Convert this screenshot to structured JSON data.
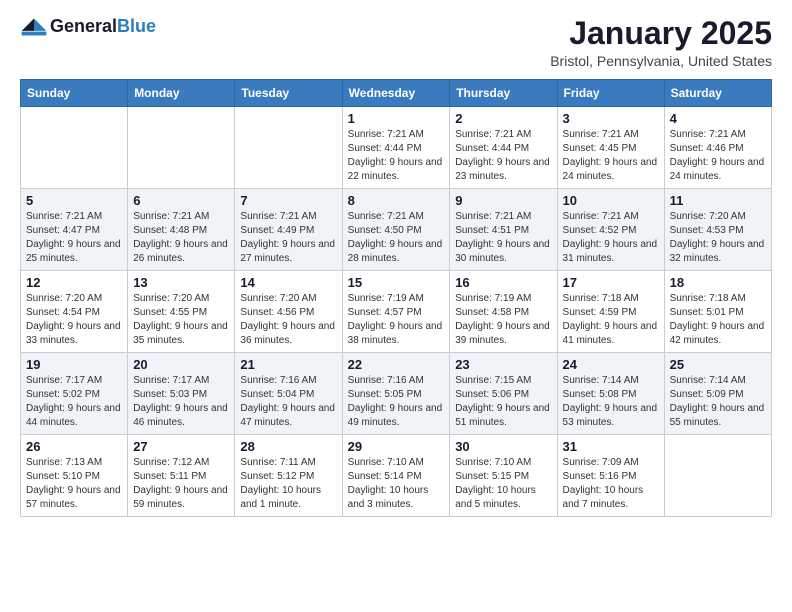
{
  "header": {
    "logo_general": "General",
    "logo_blue": "Blue",
    "month_title": "January 2025",
    "location": "Bristol, Pennsylvania, United States"
  },
  "days_of_week": [
    "Sunday",
    "Monday",
    "Tuesday",
    "Wednesday",
    "Thursday",
    "Friday",
    "Saturday"
  ],
  "weeks": [
    [
      {
        "day": "",
        "sunrise": "",
        "sunset": "",
        "daylight": ""
      },
      {
        "day": "",
        "sunrise": "",
        "sunset": "",
        "daylight": ""
      },
      {
        "day": "",
        "sunrise": "",
        "sunset": "",
        "daylight": ""
      },
      {
        "day": "1",
        "sunrise": "Sunrise: 7:21 AM",
        "sunset": "Sunset: 4:44 PM",
        "daylight": "Daylight: 9 hours and 22 minutes."
      },
      {
        "day": "2",
        "sunrise": "Sunrise: 7:21 AM",
        "sunset": "Sunset: 4:44 PM",
        "daylight": "Daylight: 9 hours and 23 minutes."
      },
      {
        "day": "3",
        "sunrise": "Sunrise: 7:21 AM",
        "sunset": "Sunset: 4:45 PM",
        "daylight": "Daylight: 9 hours and 24 minutes."
      },
      {
        "day": "4",
        "sunrise": "Sunrise: 7:21 AM",
        "sunset": "Sunset: 4:46 PM",
        "daylight": "Daylight: 9 hours and 24 minutes."
      }
    ],
    [
      {
        "day": "5",
        "sunrise": "Sunrise: 7:21 AM",
        "sunset": "Sunset: 4:47 PM",
        "daylight": "Daylight: 9 hours and 25 minutes."
      },
      {
        "day": "6",
        "sunrise": "Sunrise: 7:21 AM",
        "sunset": "Sunset: 4:48 PM",
        "daylight": "Daylight: 9 hours and 26 minutes."
      },
      {
        "day": "7",
        "sunrise": "Sunrise: 7:21 AM",
        "sunset": "Sunset: 4:49 PM",
        "daylight": "Daylight: 9 hours and 27 minutes."
      },
      {
        "day": "8",
        "sunrise": "Sunrise: 7:21 AM",
        "sunset": "Sunset: 4:50 PM",
        "daylight": "Daylight: 9 hours and 28 minutes."
      },
      {
        "day": "9",
        "sunrise": "Sunrise: 7:21 AM",
        "sunset": "Sunset: 4:51 PM",
        "daylight": "Daylight: 9 hours and 30 minutes."
      },
      {
        "day": "10",
        "sunrise": "Sunrise: 7:21 AM",
        "sunset": "Sunset: 4:52 PM",
        "daylight": "Daylight: 9 hours and 31 minutes."
      },
      {
        "day": "11",
        "sunrise": "Sunrise: 7:20 AM",
        "sunset": "Sunset: 4:53 PM",
        "daylight": "Daylight: 9 hours and 32 minutes."
      }
    ],
    [
      {
        "day": "12",
        "sunrise": "Sunrise: 7:20 AM",
        "sunset": "Sunset: 4:54 PM",
        "daylight": "Daylight: 9 hours and 33 minutes."
      },
      {
        "day": "13",
        "sunrise": "Sunrise: 7:20 AM",
        "sunset": "Sunset: 4:55 PM",
        "daylight": "Daylight: 9 hours and 35 minutes."
      },
      {
        "day": "14",
        "sunrise": "Sunrise: 7:20 AM",
        "sunset": "Sunset: 4:56 PM",
        "daylight": "Daylight: 9 hours and 36 minutes."
      },
      {
        "day": "15",
        "sunrise": "Sunrise: 7:19 AM",
        "sunset": "Sunset: 4:57 PM",
        "daylight": "Daylight: 9 hours and 38 minutes."
      },
      {
        "day": "16",
        "sunrise": "Sunrise: 7:19 AM",
        "sunset": "Sunset: 4:58 PM",
        "daylight": "Daylight: 9 hours and 39 minutes."
      },
      {
        "day": "17",
        "sunrise": "Sunrise: 7:18 AM",
        "sunset": "Sunset: 4:59 PM",
        "daylight": "Daylight: 9 hours and 41 minutes."
      },
      {
        "day": "18",
        "sunrise": "Sunrise: 7:18 AM",
        "sunset": "Sunset: 5:01 PM",
        "daylight": "Daylight: 9 hours and 42 minutes."
      }
    ],
    [
      {
        "day": "19",
        "sunrise": "Sunrise: 7:17 AM",
        "sunset": "Sunset: 5:02 PM",
        "daylight": "Daylight: 9 hours and 44 minutes."
      },
      {
        "day": "20",
        "sunrise": "Sunrise: 7:17 AM",
        "sunset": "Sunset: 5:03 PM",
        "daylight": "Daylight: 9 hours and 46 minutes."
      },
      {
        "day": "21",
        "sunrise": "Sunrise: 7:16 AM",
        "sunset": "Sunset: 5:04 PM",
        "daylight": "Daylight: 9 hours and 47 minutes."
      },
      {
        "day": "22",
        "sunrise": "Sunrise: 7:16 AM",
        "sunset": "Sunset: 5:05 PM",
        "daylight": "Daylight: 9 hours and 49 minutes."
      },
      {
        "day": "23",
        "sunrise": "Sunrise: 7:15 AM",
        "sunset": "Sunset: 5:06 PM",
        "daylight": "Daylight: 9 hours and 51 minutes."
      },
      {
        "day": "24",
        "sunrise": "Sunrise: 7:14 AM",
        "sunset": "Sunset: 5:08 PM",
        "daylight": "Daylight: 9 hours and 53 minutes."
      },
      {
        "day": "25",
        "sunrise": "Sunrise: 7:14 AM",
        "sunset": "Sunset: 5:09 PM",
        "daylight": "Daylight: 9 hours and 55 minutes."
      }
    ],
    [
      {
        "day": "26",
        "sunrise": "Sunrise: 7:13 AM",
        "sunset": "Sunset: 5:10 PM",
        "daylight": "Daylight: 9 hours and 57 minutes."
      },
      {
        "day": "27",
        "sunrise": "Sunrise: 7:12 AM",
        "sunset": "Sunset: 5:11 PM",
        "daylight": "Daylight: 9 hours and 59 minutes."
      },
      {
        "day": "28",
        "sunrise": "Sunrise: 7:11 AM",
        "sunset": "Sunset: 5:12 PM",
        "daylight": "Daylight: 10 hours and 1 minute."
      },
      {
        "day": "29",
        "sunrise": "Sunrise: 7:10 AM",
        "sunset": "Sunset: 5:14 PM",
        "daylight": "Daylight: 10 hours and 3 minutes."
      },
      {
        "day": "30",
        "sunrise": "Sunrise: 7:10 AM",
        "sunset": "Sunset: 5:15 PM",
        "daylight": "Daylight: 10 hours and 5 minutes."
      },
      {
        "day": "31",
        "sunrise": "Sunrise: 7:09 AM",
        "sunset": "Sunset: 5:16 PM",
        "daylight": "Daylight: 10 hours and 7 minutes."
      },
      {
        "day": "",
        "sunrise": "",
        "sunset": "",
        "daylight": ""
      }
    ]
  ]
}
